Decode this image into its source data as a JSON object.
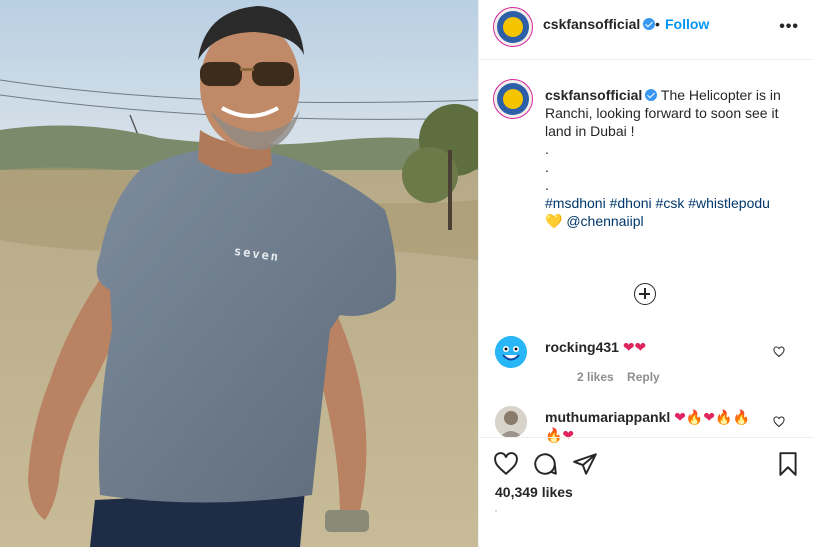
{
  "post": {
    "author": "cskfansofficial",
    "follow_label": "Follow",
    "separator": "•",
    "more_label": "•••",
    "caption_author": "cskfansofficial",
    "caption_line1": "The Helicopter is in Ranchi, looking forward to soon see it land in Dubai !",
    "caption_dot1": ".",
    "caption_dot2": ".",
    "caption_dot3": ".",
    "hashtags": [
      "#msdhoni",
      "#dhoni",
      "#csk",
      "#whistlepodu"
    ],
    "heart_emoji": "💛",
    "mention": "@chennaiipl",
    "likes": "40,349 likes",
    "shirt_text": "seven"
  },
  "comments": [
    {
      "username": "rocking431",
      "text": "❤❤",
      "likes": "2 likes",
      "reply_label": "Reply"
    },
    {
      "username": "muthumariappankl",
      "text": "❤🔥❤🔥🔥",
      "text2": "🔥❤"
    }
  ],
  "icons": {
    "header_avatar": "csk-lion-logo",
    "verified": "verified-badge-icon",
    "load_more": "plus-circle-icon",
    "like": "heart-outline-icon",
    "comment": "comment-bubble-icon",
    "share": "paper-plane-icon",
    "save": "bookmark-icon"
  },
  "colors": {
    "accent": "#0095f6",
    "verified": "#3897f0",
    "hashtag": "#00376b",
    "text": "#262626",
    "muted": "#8e8e8e"
  }
}
